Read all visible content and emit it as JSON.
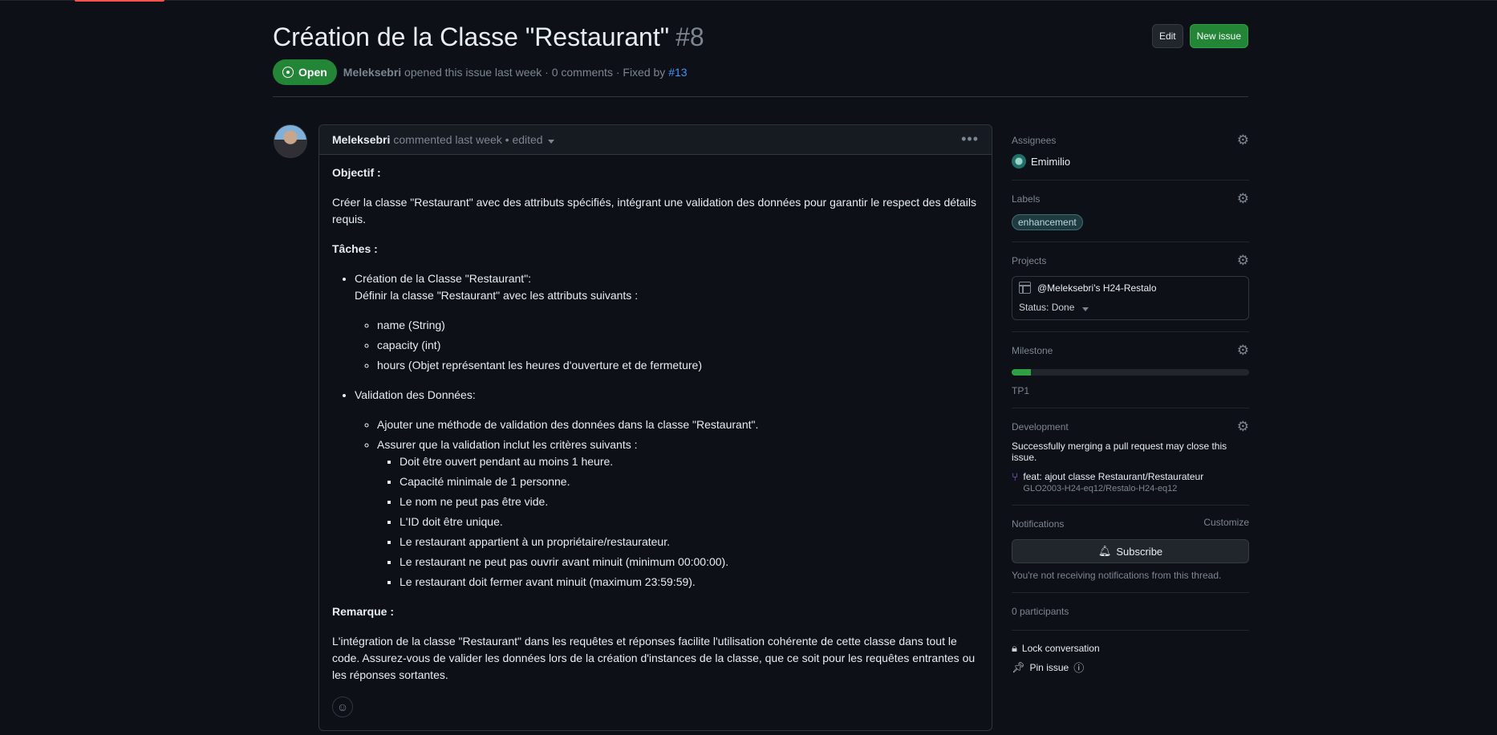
{
  "issue": {
    "title": "Création de la Classe \"Restaurant\"",
    "number": "#8",
    "edit_label": "Edit",
    "new_issue_label": "New issue",
    "state": "Open",
    "author": "Meleksebri",
    "opened_text": "opened this issue last week · 0 comments · Fixed by",
    "fixed_by": "#13"
  },
  "comment": {
    "author": "Meleksebri",
    "meta": "commented last week • edited",
    "objectif_heading": "Objectif :",
    "objectif_text": "Créer la classe \"Restaurant\" avec des attributs spécifiés, intégrant une validation des données pour garantir le respect des détails requis.",
    "taches_heading": "Tâches :",
    "task1_title": "Création de la Classe \"Restaurant\":",
    "task1_desc": "Définir la classe \"Restaurant\" avec les attributs suivants :",
    "attributes": [
      "name (String)",
      "capacity (int)",
      "hours (Objet représentant les heures d'ouverture et de fermeture)"
    ],
    "task2_title": "Validation des Données:",
    "validation_items": [
      "Ajouter une méthode de validation des données dans la classe \"Restaurant\".",
      "Assurer que la validation inclut les critères suivants :"
    ],
    "criteria": [
      "Doit être ouvert pendant au moins 1 heure.",
      "Capacité minimale de 1 personne.",
      "Le nom ne peut pas être vide.",
      "L'ID doit être unique.",
      "Le restaurant appartient à un propriétaire/restaurateur.",
      "Le restaurant ne peut pas ouvrir avant minuit (minimum 00:00:00).",
      "Le restaurant doit fermer avant minuit (maximum 23:59:59)."
    ],
    "remarque_heading": "Remarque :",
    "remarque_text": "L'intégration de la classe \"Restaurant\" dans les requêtes et réponses facilite l'utilisation cohérente de cette classe dans tout le code. Assurez-vous de valider les données lors de la création d'instances de la classe, que ce soit pour les requêtes entrantes ou les réponses sortantes."
  },
  "sidebar": {
    "assignees_title": "Assignees",
    "assignee": "Emimilio",
    "labels_title": "Labels",
    "label": "enhancement",
    "projects_title": "Projects",
    "project_name": "@Meleksebri's H24-Restalo",
    "project_status": "Status: Done",
    "milestone_title": "Milestone",
    "milestone_progress": 0.08,
    "milestone_name": "TP1",
    "development_title": "Development",
    "development_note": "Successfully merging a pull request may close this issue.",
    "pr_title": "feat: ajout classe Restaurant/Restaurateur",
    "pr_repo": "GLO2003-H24-eq12/Restalo-H24-eq12",
    "notifications_title": "Notifications",
    "customize_label": "Customize",
    "subscribe_label": "Subscribe",
    "notifications_note": "You're not receiving notifications from this thread.",
    "participants": "0 participants",
    "lock_label": "Lock conversation",
    "pin_label": "Pin issue"
  },
  "icons": {
    "state": "issue-opened-icon",
    "gear": "gear-icon",
    "bell": "bell-icon",
    "lock": "lock-icon",
    "pin": "pin-icon",
    "pr": "git-pull-request-icon",
    "smiley": "smiley-icon",
    "table": "table-icon",
    "info": "info-icon"
  },
  "colors": {
    "open_green": "#238636",
    "link_blue": "#4493f8",
    "background": "#0d1117"
  }
}
